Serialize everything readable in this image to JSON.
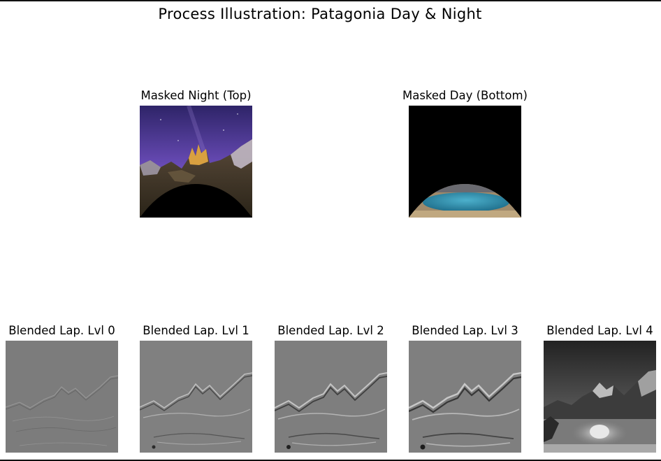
{
  "figure": {
    "title": "Process Illustration: Patagonia Day & Night"
  },
  "top_row": [
    {
      "title": "Masked Night (Top)",
      "image": "night-mountains-masked"
    },
    {
      "title": "Masked Day (Bottom)",
      "image": "day-lake-masked"
    }
  ],
  "bottom_row": [
    {
      "title": "Blended Lap. Lvl 0",
      "image": "laplacian-level-0"
    },
    {
      "title": "Blended Lap. Lvl 1",
      "image": "laplacian-level-1"
    },
    {
      "title": "Blended Lap. Lvl 2",
      "image": "laplacian-level-2"
    },
    {
      "title": "Blended Lap. Lvl 3",
      "image": "laplacian-level-3"
    },
    {
      "title": "Blended Lap. Lvl 4",
      "image": "laplacian-level-4"
    }
  ],
  "colors": {
    "night_sky_top": "#3a2a7a",
    "night_sky_bottom": "#7a5cc0",
    "peaks_lit": "#d9a040",
    "lake": "#2f8fb0",
    "mask": "#000000",
    "laplacian_gray": "#808080"
  }
}
